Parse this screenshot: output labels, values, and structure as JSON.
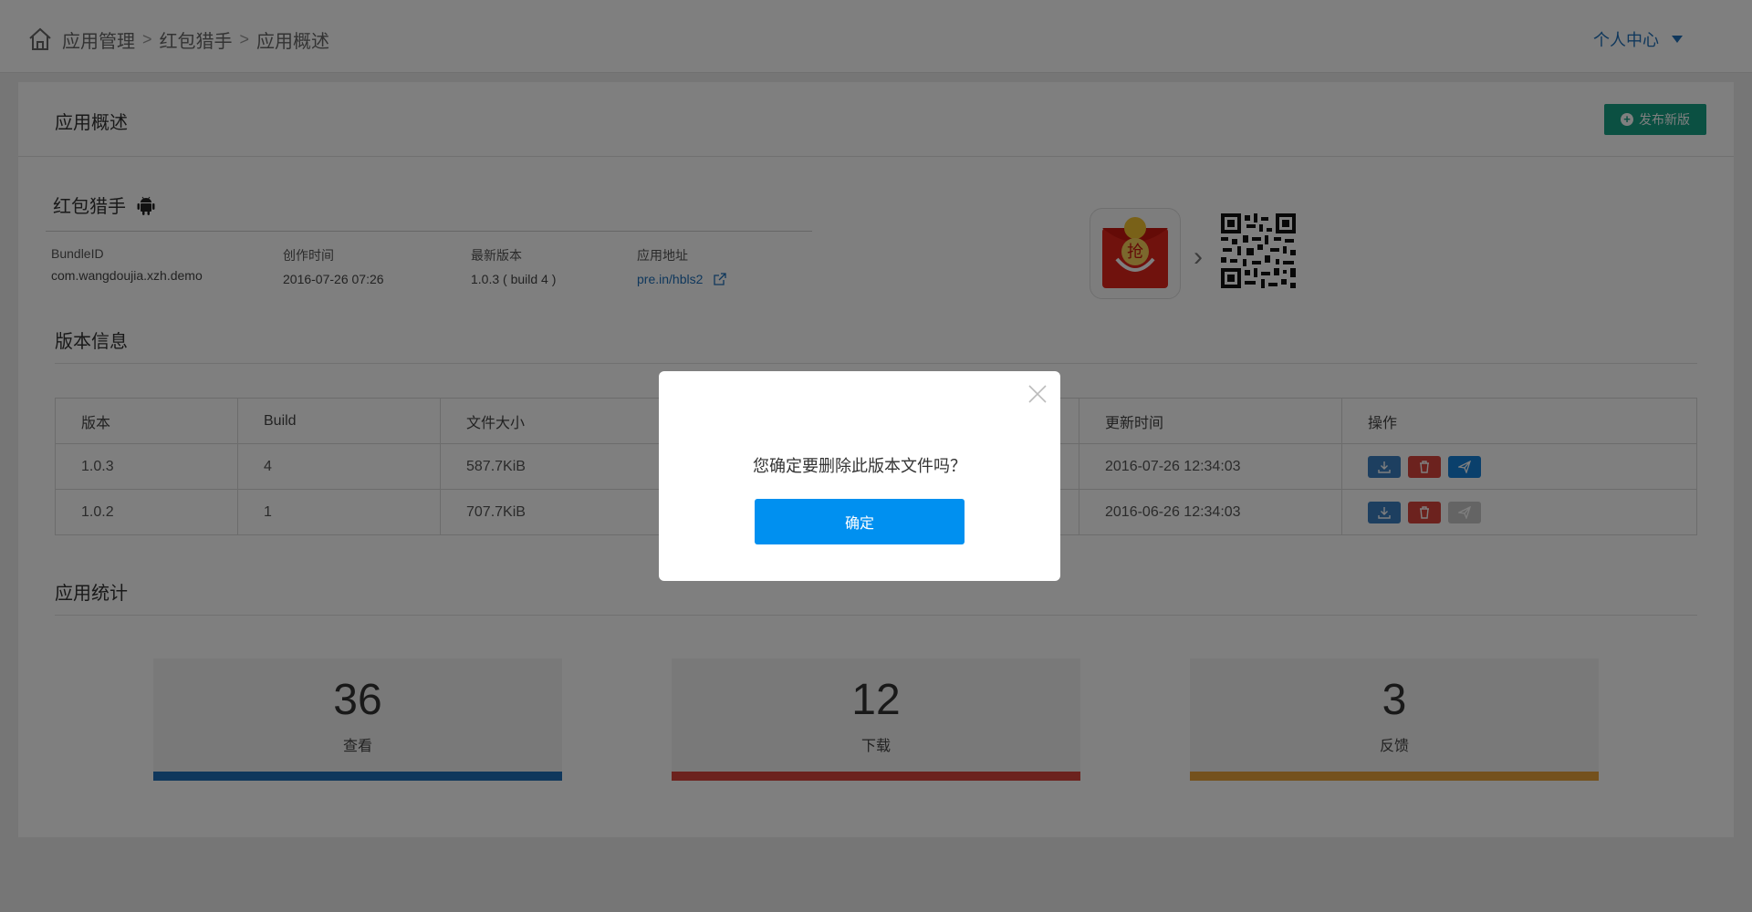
{
  "breadcrumb": {
    "items": [
      "应用管理",
      "红包猎手",
      "应用概述"
    ],
    "separator": ">"
  },
  "user_menu": {
    "label": "个人中心"
  },
  "panel": {
    "title": "应用概述",
    "publish_label": "发布新版"
  },
  "app": {
    "name": "红包猎手",
    "platform_icon": "android-icon",
    "fields": [
      {
        "label": "BundleID",
        "value": "com.wangdoujia.xzh.demo"
      },
      {
        "label": "创作时间",
        "value": "2016-07-26 07:26"
      },
      {
        "label": "最新版本",
        "value": "1.0.3 ( build 4 )"
      },
      {
        "label": "应用地址",
        "value": "pre.in/hbls2"
      }
    ],
    "icon_text": "抢"
  },
  "versions": {
    "title": "版本信息",
    "columns": [
      "版本",
      "Build",
      "文件大小",
      "",
      "更新时间",
      "操作"
    ],
    "rows": [
      {
        "version": "1.0.3",
        "build": "4",
        "size": "587.7KiB",
        "hidden": "",
        "updated": "2016-07-26 12:34:03",
        "send_enabled": true
      },
      {
        "version": "1.0.2",
        "build": "1",
        "size": "707.7KiB",
        "hidden": "",
        "updated": "2016-06-26 12:34:03",
        "send_enabled": false
      }
    ]
  },
  "stats": {
    "title": "应用统计",
    "items": [
      {
        "value": "36",
        "label": "查看",
        "color": "#1e6fb8"
      },
      {
        "value": "12",
        "label": "下载",
        "color": "#d9453c"
      },
      {
        "value": "3",
        "label": "反馈",
        "color": "#e8a23a"
      }
    ]
  },
  "dialog": {
    "message": "您确定要删除此版本文件吗？",
    "confirm_label": "确定"
  },
  "colors": {
    "accent": "#0090f0",
    "publish": "#16a085",
    "link": "#1e6fb8"
  }
}
